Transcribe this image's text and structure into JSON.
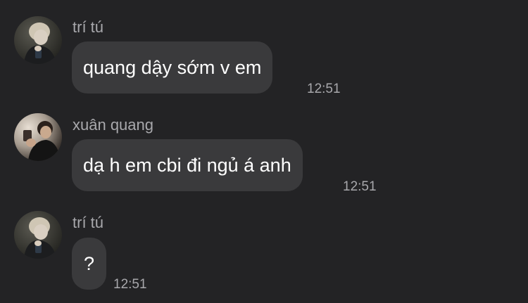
{
  "messages": [
    {
      "sender": "trí tú",
      "text": "quang dậy sớm v em",
      "time": "12:51",
      "avatar": "profile-photo-tri-tu"
    },
    {
      "sender": "xuân quang",
      "text": "dạ h em cbi đi ngủ á anh",
      "time": "12:51",
      "avatar": "profile-photo-xuan-quang"
    },
    {
      "sender": "trí tú",
      "text": "?",
      "time": "12:51",
      "avatar": "profile-photo-tri-tu"
    }
  ],
  "colors": {
    "background": "#232325",
    "bubble": "#3a3a3c",
    "secondary_text": "#a8a8ac",
    "message_text": "#ffffff"
  }
}
